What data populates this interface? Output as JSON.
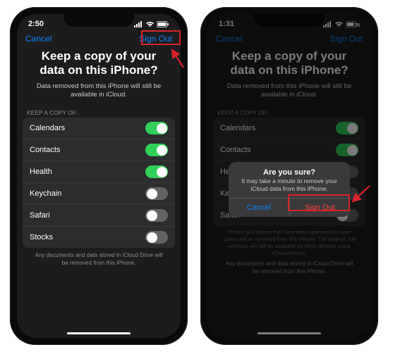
{
  "left": {
    "time": "2:50",
    "cancel": "Cancel",
    "signout": "Sign Out",
    "title": "Keep a copy of your data on this iPhone?",
    "subtitle": "Data removed from this iPhone will still be available in iCloud.",
    "section": "KEEP A COPY OF:",
    "items": [
      {
        "label": "Calendars",
        "on": true
      },
      {
        "label": "Contacts",
        "on": true
      },
      {
        "label": "Health",
        "on": true
      },
      {
        "label": "Keychain",
        "on": false
      },
      {
        "label": "Safari",
        "on": false
      },
      {
        "label": "Stocks",
        "on": false
      }
    ],
    "footnote": "Any documents and data stored in iCloud Drive will be removed from this iPhone."
  },
  "right": {
    "time": "1:31",
    "cancel": "Cancel",
    "signout": "Sign Out",
    "title": "Keep a copy of your data on this iPhone?",
    "subtitle": "Data removed from this iPhone will still be available in iCloud.",
    "section": "KEEP A COPY OF:",
    "items": [
      {
        "label": "Calendars",
        "on": true
      },
      {
        "label": "Contacts",
        "on": true
      },
      {
        "label": "Health",
        "on": false
      },
      {
        "label": "Keychain",
        "on": false
      },
      {
        "label": "Safari",
        "on": false
      }
    ],
    "alert": {
      "title": "Are you sure?",
      "message": "It may take a minute to remove your iCloud data from this iPhone.",
      "cancel": "Cancel",
      "signout": "Sign Out"
    },
    "photos_note": "Photos and videos that have been optimized to save space will be removed from this iPhone. The original, full versions will still be available on other devices using iCloud Photos.",
    "footnote": "Any documents and data stored in iCloud Drive will be removed from this iPhone."
  }
}
